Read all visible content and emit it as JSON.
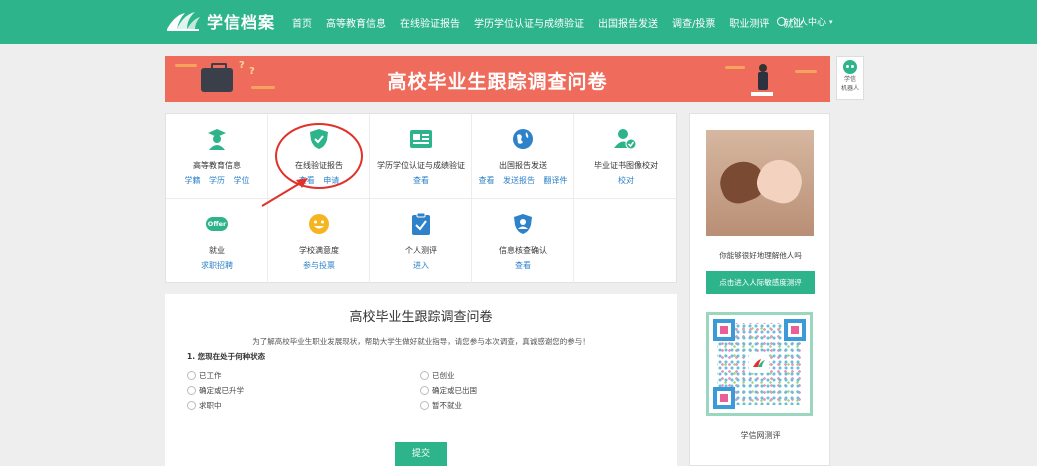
{
  "header": {
    "logo_text": "学信档案",
    "nav": [
      "首页",
      "高等教育信息",
      "在线验证报告",
      "学历学位认证与成绩验证",
      "出国报告发送",
      "调查/投票",
      "职业测评",
      "就业"
    ],
    "user_center": "个人中心"
  },
  "banner": {
    "title": "高校毕业生跟踪调查问卷"
  },
  "robot": {
    "line1": "学信",
    "line2": "机器人"
  },
  "services": [
    {
      "title": "高等教育信息",
      "links": [
        "学籍",
        "学历",
        "学位"
      ],
      "icon": "graduate-icon"
    },
    {
      "title": "在线验证报告",
      "links": [
        "查看",
        "申请"
      ],
      "icon": "shield-check-icon"
    },
    {
      "title": "学历学位认证与成绩验证",
      "links": [
        "查看"
      ],
      "icon": "certificate-icon"
    },
    {
      "title": "出国报告发送",
      "links": [
        "查看",
        "发送报告",
        "翻译件"
      ],
      "icon": "globe-icon"
    },
    {
      "title": "毕业证书图像校对",
      "links": [
        "校对"
      ],
      "icon": "user-check-icon"
    },
    {
      "title": "就业",
      "links": [
        "求职招聘"
      ],
      "icon": "offer-icon",
      "icon_text": "Offer"
    },
    {
      "title": "学校满意度",
      "links": [
        "参与投票"
      ],
      "icon": "smiley-icon"
    },
    {
      "title": "个人测评",
      "links": [
        "进入"
      ],
      "icon": "clipboard-check-icon"
    },
    {
      "title": "信息核查确认",
      "links": [
        "查看"
      ],
      "icon": "verify-badge-icon"
    }
  ],
  "survey": {
    "title": "高校毕业生跟踪调查问卷",
    "intro": "为了解高校毕业生职业发展现状，帮助大学生做好就业指导，请您参与本次调查，真诚感谢您的参与！",
    "question": "1. 您现在处于何种状态",
    "options_left": [
      "已工作",
      "确定或已升学",
      "求职中"
    ],
    "options_right": [
      "已创业",
      "确定或已出国",
      "暂不就业"
    ],
    "submit_label": "提交"
  },
  "side": {
    "caption": "你能够很好地理解他人吗",
    "button": "点击进入人际敏感度测评",
    "qr_label": "学信网测评"
  },
  "colors": {
    "brand": "#2db48a",
    "banner": "#ef6b5b",
    "link": "#2e82c9",
    "annotation": "#e0312a"
  }
}
